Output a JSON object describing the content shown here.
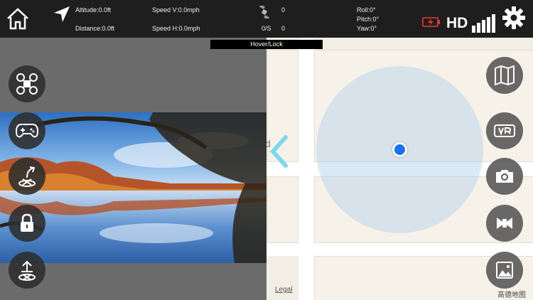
{
  "topbar": {
    "home_icon": "home-icon",
    "nav_icon": "navigation-arrow-icon",
    "altitude": "Altitude:0.0ft",
    "distance": "Distance:0.0ft",
    "speed_v": "Speed V:0.0mph",
    "speed_h": "Speed H:0.0mph",
    "satellite_icon": "satellite-icon",
    "satellite_count": "0",
    "signal_label": "0/S",
    "signal_value": "0",
    "roll": "Roll:0°",
    "pitch": "Pitch:0°",
    "yaw": "Yaw:0°",
    "battery_icon": "battery-low-icon",
    "hd_label": "HD",
    "signal_bars_icon": "signal-bars-icon",
    "settings_icon": "gear-icon"
  },
  "status_banner": "Hover/Lock",
  "left_buttons": [
    {
      "name": "drone-icon"
    },
    {
      "name": "gamepad-icon"
    },
    {
      "name": "takeoff-icon"
    },
    {
      "name": "lock-icon"
    },
    {
      "name": "landing-icon"
    }
  ],
  "right_buttons": [
    {
      "name": "map-icon"
    },
    {
      "name": "vr-icon"
    },
    {
      "name": "camera-icon"
    },
    {
      "name": "video-icon"
    },
    {
      "name": "gallery-icon"
    }
  ],
  "map": {
    "legal_label": "Legal",
    "brand": "高德地图",
    "letter": "d"
  },
  "colors": {
    "accent_blue": "#1a73e8",
    "arrow_cyan": "#7fd6ef",
    "battery_red": "#e53935"
  }
}
